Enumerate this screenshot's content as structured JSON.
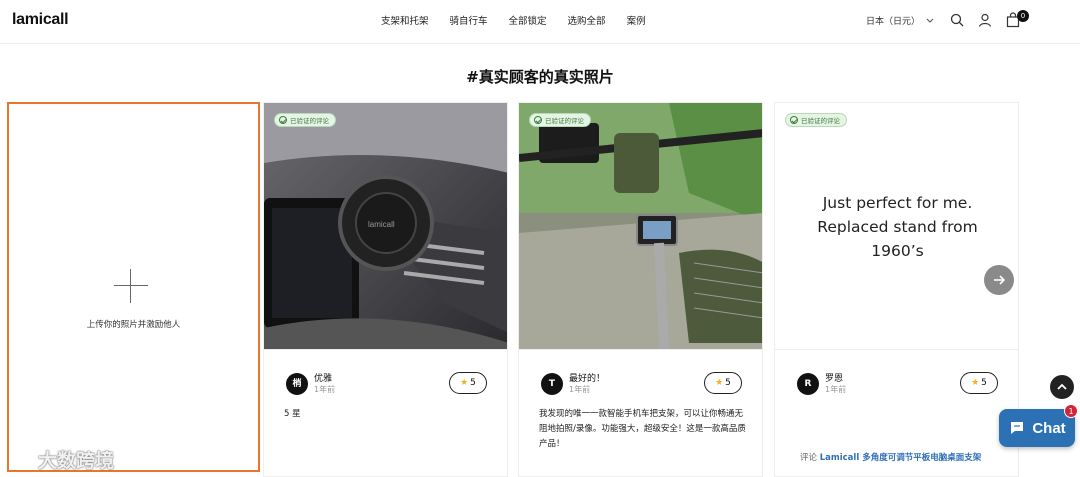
{
  "header": {
    "logo": "lamicall",
    "nav": [
      "支架和托架",
      "骑自行车",
      "全部锁定",
      "选购全部",
      "案例"
    ],
    "locale": "日本（日元）",
    "cart_count": "0"
  },
  "section_title": "#真实顾客的真实照片",
  "upload": {
    "text": "上传你的照片并激励他人"
  },
  "watermark": "大数跨境",
  "verified_label": "已验证的评论",
  "reviews": [
    {
      "avatar": "梢",
      "name": "优雅",
      "time": "1年前",
      "rating": "5",
      "body": "5 星"
    },
    {
      "avatar": "T",
      "name": "最好的！",
      "time": "1年前",
      "rating": "5",
      "body": "我发现的唯一一款智能手机车把支架，可以让你畅通无阻地拍照/录像。功能强大，超级安全！这是一款高品质产品！"
    },
    {
      "avatar": "R",
      "name": "罗恩",
      "time": "1年前",
      "rating": "5",
      "quote": "Just perfect for me. Replaced stand from 1960’s",
      "link_prefix": "评论",
      "link_product": "Lamicall 多角度可调节平板电脑桌面支架"
    }
  ],
  "chat": {
    "label": "Chat",
    "badge": "1"
  },
  "colors": {
    "upload_border": "#e8762d",
    "chat_bg": "#2b71b3",
    "verified_green": "#3a7d3a",
    "star": "#f2b01e",
    "link_blue": "#2f6fb8"
  }
}
